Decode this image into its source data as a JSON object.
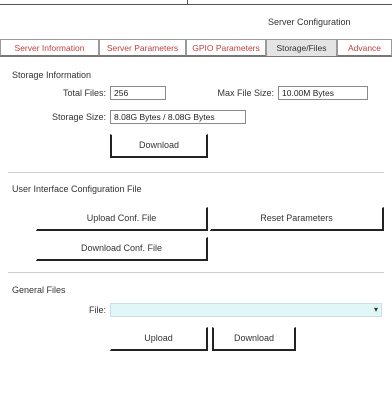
{
  "window": {
    "title": "Server Configuration"
  },
  "tabs": [
    {
      "label": "Server Information",
      "active": false
    },
    {
      "label": "Server Parameters",
      "active": false
    },
    {
      "label": "GPIO Parameters",
      "active": false
    },
    {
      "label": "Storage/Files",
      "active": true
    },
    {
      "label": "Advance",
      "active": false
    }
  ],
  "storage": {
    "section_title": "Storage Information",
    "total_files_label": "Total Files:",
    "total_files_value": "256",
    "max_file_size_label": "Max File Size:",
    "max_file_size_value": "10.00M Bytes",
    "storage_size_label": "Storage Size:",
    "storage_size_value": "8.08G Bytes / 8.08G Bytes",
    "download_label": "Download"
  },
  "ui_config": {
    "section_title": "User Interface Configuration File",
    "upload_label": "Upload Conf. File",
    "reset_label": "Reset Parameters",
    "download_label": "Download Conf. File"
  },
  "general_files": {
    "section_title": "General Files",
    "file_label": "File:",
    "file_value": "",
    "upload_label": "Upload",
    "download_label": "Download"
  },
  "colors": {
    "tab_text": "#c04040",
    "select_bg": "#dff7f7",
    "active_tab_bg": "#e4e4e4"
  }
}
